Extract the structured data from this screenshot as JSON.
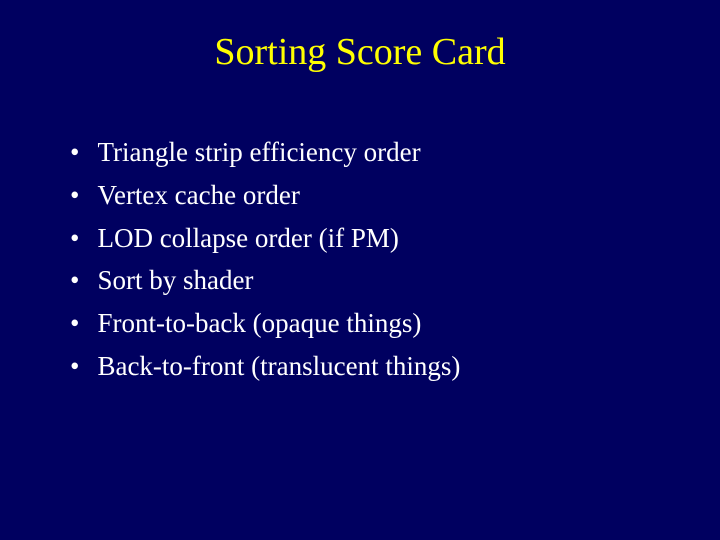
{
  "slide": {
    "title": "Sorting Score Card",
    "bullets": [
      "Triangle strip efficiency order",
      "Vertex cache order",
      "LOD collapse order (if PM)",
      "Sort by shader",
      "Front-to-back (opaque things)",
      "Back-to-front (translucent things)"
    ]
  }
}
